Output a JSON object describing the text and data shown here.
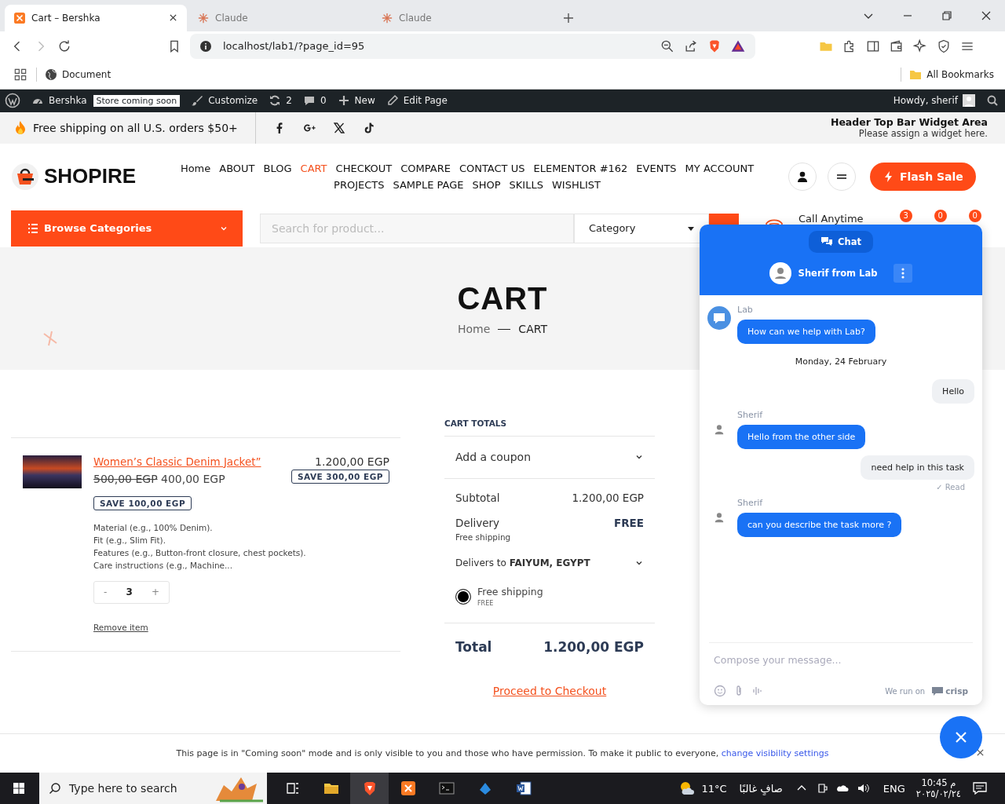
{
  "browser": {
    "tabs": [
      {
        "title": "Cart – Bershka",
        "kind": "xampp",
        "selected": true
      },
      {
        "title": "Claude",
        "kind": "claude",
        "selected": false
      },
      {
        "title": "Claude",
        "kind": "claude",
        "selected": false
      }
    ],
    "url": "localhost/lab1/?page_id=95",
    "bookmarks": [
      "Document"
    ],
    "all_bookmarks": "All Bookmarks"
  },
  "admin_bar": {
    "site": "Bershka",
    "badge": "Store coming soon",
    "items": [
      {
        "label": "Customize",
        "kind": "brush"
      },
      {
        "label": "2",
        "kind": "updates"
      },
      {
        "label": "0",
        "kind": "comments"
      },
      {
        "label": "New",
        "kind": "new"
      },
      {
        "label": "Edit Page",
        "kind": "edit"
      }
    ],
    "greeting": "Howdy, sherif"
  },
  "top_bar": {
    "shipping_notice": "Free shipping on all U.S. orders $50+",
    "social": [
      {
        "kind": "facebook"
      },
      {
        "kind": "google-plus"
      },
      {
        "kind": "x"
      },
      {
        "kind": "tiktok"
      }
    ],
    "widget_title": "Header Top Bar Widget Area",
    "widget_hint": "Please assign a widget here."
  },
  "header": {
    "logo": "SHOPIRE",
    "nav": [
      {
        "label": "Home",
        "selected": false
      },
      {
        "label": "ABOUT",
        "selected": false
      },
      {
        "label": "BLOG",
        "selected": false
      },
      {
        "label": "CART",
        "selected": true
      },
      {
        "label": "CHECKOUT",
        "selected": false
      },
      {
        "label": "COMPARE",
        "selected": false
      },
      {
        "label": "CONTACT US",
        "selected": false
      },
      {
        "label": "ELEMENTOR #162",
        "selected": false
      },
      {
        "label": "EVENTS",
        "selected": false
      },
      {
        "label": "MY ACCOUNT",
        "selected": false
      },
      {
        "label": "PROJECTS",
        "selected": false
      },
      {
        "label": "SAMPLE PAGE",
        "selected": false
      },
      {
        "label": "SHOP",
        "selected": false
      },
      {
        "label": "SKILLS",
        "selected": false
      },
      {
        "label": "WISHLIST",
        "selected": false
      }
    ],
    "flash_sale": "Flash Sale"
  },
  "search_bar": {
    "browse": "Browse Categories",
    "placeholder": "Search for product...",
    "category": "Category",
    "call": "Call Anytime",
    "counters": [
      "3",
      "0",
      "0"
    ]
  },
  "hero": {
    "title": "CART",
    "breadcrumb": [
      "Home",
      "CART"
    ]
  },
  "cart": {
    "item": {
      "name": "Women’s Classic Denim Jacket”",
      "old_price": "500,00 EGP",
      "price": "400,00 EGP",
      "save": "SAVE 100,00 EGP",
      "line_total": "1.200,00 EGP",
      "line_save": "SAVE 300,00 EGP",
      "details": [
        "Material (e.g., 100% Denim).",
        "Fit (e.g., Slim Fit).",
        "Features (e.g., Button-front closure, chest pockets).",
        "Care instructions (e.g., Machine..."
      ],
      "minus": "-",
      "quantity": "3",
      "plus": "+",
      "remove": "Remove item"
    }
  },
  "totals": {
    "heading": "CART TOTALS",
    "coupon": "Add a coupon",
    "subtotal_label": "Subtotal",
    "subtotal": "1.200,00 EGP",
    "delivery_label": "Delivery",
    "delivery": "FREE",
    "delivery_method": "Free shipping",
    "delivers_to": "Delivers to **FAIYUM, EGYPT**",
    "shipping_options": [
      {
        "label": "Free shipping",
        "price": "FREE",
        "selected": true
      }
    ],
    "total_label": "Total",
    "total": "1.200,00 EGP",
    "checkout": "Proceed to Checkout"
  },
  "chat": {
    "tab": "Chat",
    "agent": "Sherif from Lab",
    "messages": [
      {
        "kind": "bot",
        "sender": "Lab",
        "text": "How can we help with Lab?"
      },
      {
        "kind": "date",
        "text": "Monday, 24 February"
      },
      {
        "kind": "visitor",
        "text": "Hello"
      },
      {
        "kind": "operator",
        "sender": "Sherif",
        "text": "Hello from the other side"
      },
      {
        "kind": "visitor",
        "text": "need help in this task",
        "status": "✓ Read"
      },
      {
        "kind": "operator",
        "sender": "Sherif",
        "text": "can you describe the task more ?"
      }
    ],
    "placeholder": "Compose your message...",
    "powered": "We run on",
    "brand": "crisp"
  },
  "notice": {
    "text": "This page is in \"Coming soon\" mode and is only visible to you and those who have permission. To make it public to everyone,",
    "link": "change visibility settings"
  },
  "taskbar": {
    "search_placeholder": "Type here to search",
    "apps": [
      {
        "kind": "taskview",
        "selected": false
      },
      {
        "kind": "folder",
        "selected": false
      },
      {
        "kind": "shield",
        "selected": true
      },
      {
        "kind": "xampp",
        "selected": false
      },
      {
        "kind": "terminal",
        "selected": false
      },
      {
        "kind": "blue",
        "selected": false
      },
      {
        "kind": "word",
        "selected": false
      }
    ],
    "temperature": "11°C",
    "weather": "صافٍ غالبًا",
    "language": "ENG",
    "time": "10:45 م",
    "date": "٢٠٢٥/٠٢/٢٤"
  }
}
